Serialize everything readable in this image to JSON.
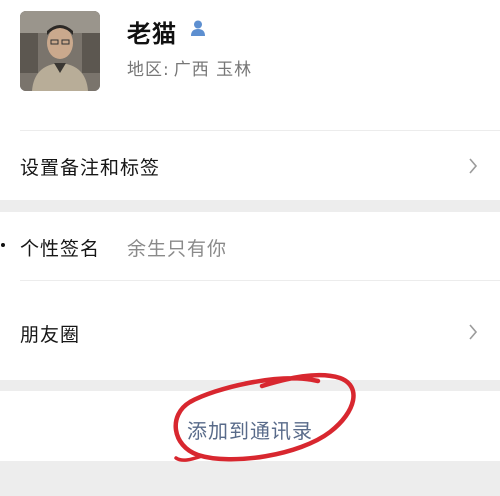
{
  "profile": {
    "name": "老猫",
    "region_label": "地区:",
    "region_value": "广西  玉林",
    "gender_icon": "person-icon",
    "gender_color": "#5d8fd0"
  },
  "menu": {
    "remark_tags": "设置备注和标签",
    "signature_label": "个性签名",
    "signature_value": "余生只有你",
    "moments": "朋友圈"
  },
  "actions": {
    "add_contact": "添加到通讯录"
  },
  "colors": {
    "annotation_circle": "#d8272f",
    "link_text": "#596b8a",
    "section_gap": "#ededed"
  }
}
